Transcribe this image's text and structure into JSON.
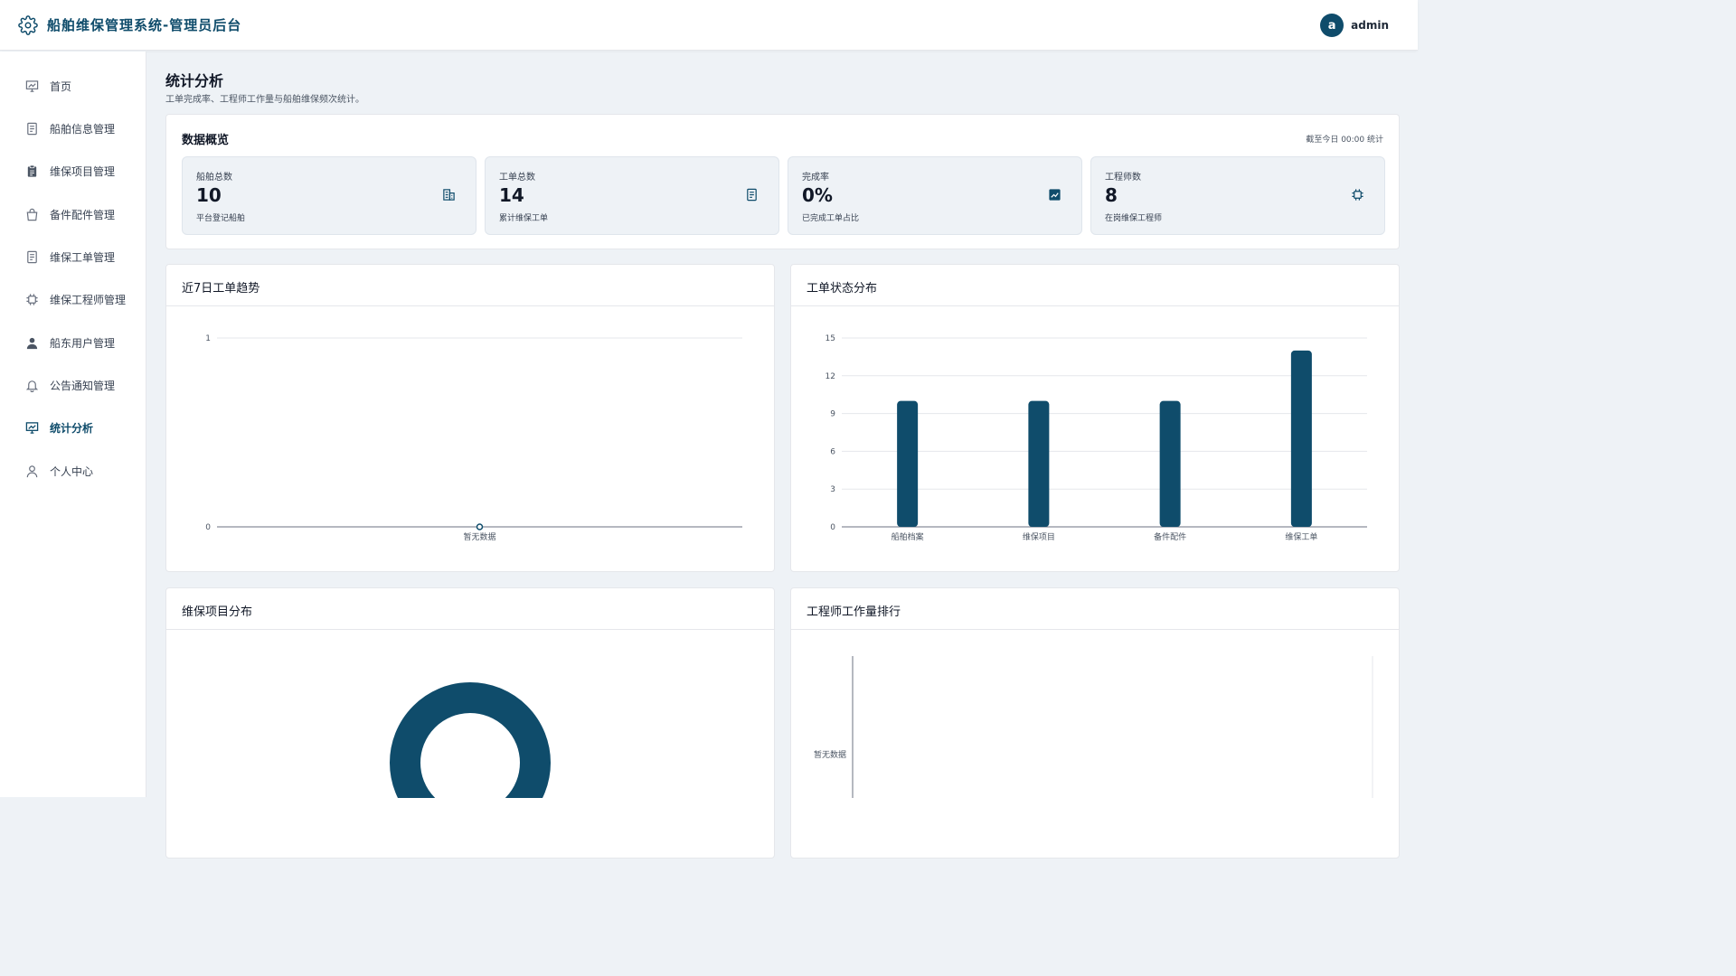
{
  "app": {
    "title": "船舶维保管理系统-管理员后台"
  },
  "user": {
    "avatar_letter": "a",
    "name": "admin"
  },
  "sidebar": {
    "items": [
      {
        "label": "首页",
        "icon": "dashboard-icon"
      },
      {
        "label": "船舶信息管理",
        "icon": "document-icon"
      },
      {
        "label": "维保项目管理",
        "icon": "clipboard-icon"
      },
      {
        "label": "备件配件管理",
        "icon": "bag-icon"
      },
      {
        "label": "维保工单管理",
        "icon": "document-icon"
      },
      {
        "label": "维保工程师管理",
        "icon": "chip-icon"
      },
      {
        "label": "船东用户管理",
        "icon": "user-solid-icon"
      },
      {
        "label": "公告通知管理",
        "icon": "bell-icon"
      },
      {
        "label": "统计分析",
        "icon": "chart-icon",
        "active": true
      },
      {
        "label": "个人中心",
        "icon": "user-icon"
      }
    ]
  },
  "page": {
    "title": "统计分析",
    "subtitle": "工单完成率、工程师工作量与船舶维保频次统计。"
  },
  "overview": {
    "title": "数据概览",
    "note": "截至今日 00:00 统计",
    "stats": [
      {
        "label": "船舶总数",
        "value": "10",
        "sub": "平台登记船舶",
        "icon": "building-icon"
      },
      {
        "label": "工单总数",
        "value": "14",
        "sub": "累计维保工单",
        "icon": "document-icon"
      },
      {
        "label": "完成率",
        "value": "0%",
        "sub": "已完成工单占比",
        "icon": "trend-icon"
      },
      {
        "label": "工程师数",
        "value": "8",
        "sub": "在岗维保工程师",
        "icon": "chip-icon"
      }
    ]
  },
  "panels": {
    "trend": {
      "title": "近7日工单趋势"
    },
    "status": {
      "title": "工单状态分布"
    },
    "project": {
      "title": "维保项目分布"
    },
    "engineer": {
      "title": "工程师工作量排行"
    }
  },
  "colors": {
    "primary": "#0f4c6b",
    "background": "#eef2f6"
  },
  "chart_data": [
    {
      "type": "line",
      "x": [
        "暂无数据"
      ],
      "values": [
        0
      ],
      "ylim": [
        0,
        1
      ],
      "yticks": [
        0,
        1
      ],
      "grid": true
    },
    {
      "type": "bar",
      "categories": [
        "船舶档案",
        "维保项目",
        "备件配件",
        "维保工单"
      ],
      "values": [
        10,
        10,
        10,
        14
      ],
      "ylim": [
        0,
        15
      ],
      "yticks": [
        0,
        3,
        6,
        9,
        12,
        15
      ],
      "grid": true,
      "color": "#0f4c6b"
    },
    {
      "type": "pie",
      "donut": true,
      "color": "#0f4c6b"
    },
    {
      "type": "bar",
      "orientation": "horizontal",
      "categories": [
        "暂无数据"
      ],
      "values": []
    }
  ]
}
